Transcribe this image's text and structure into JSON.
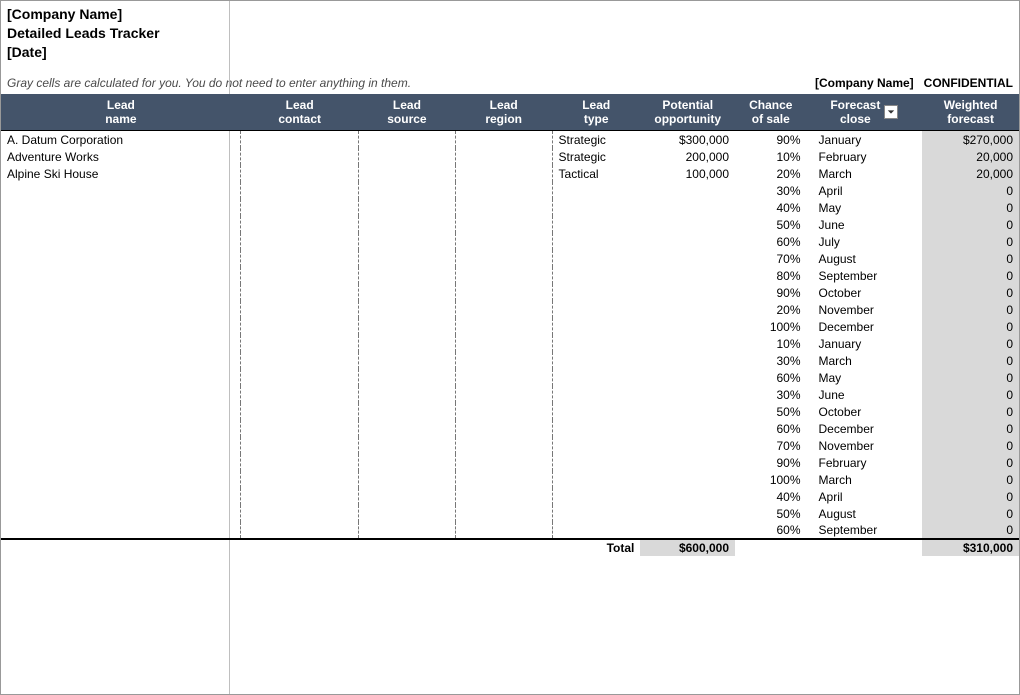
{
  "header": {
    "company_line": "[Company Name]",
    "title_line": "Detailed Leads Tracker",
    "date_line": "[Date]"
  },
  "note": "Gray cells are calculated for you. You do not need to enter anything in them.",
  "confidential": {
    "company": "[Company Name]",
    "label": "CONFIDENTIAL"
  },
  "columns": {
    "name": "Lead\nname",
    "contact": "Lead\ncontact",
    "source": "Lead\nsource",
    "region": "Lead\nregion",
    "type": "Lead\ntype",
    "potential": "Potential\nopportunity",
    "chance": "Chance\nof sale",
    "close": "Forecast\nclose",
    "weighted": "Weighted\nforecast"
  },
  "rows": [
    {
      "name": "A. Datum Corporation",
      "contact": "",
      "source": "",
      "region": "",
      "type": "Strategic",
      "potential": "$300,000",
      "chance": "90%",
      "close": "January",
      "weighted": "$270,000"
    },
    {
      "name": "Adventure Works",
      "contact": "",
      "source": "",
      "region": "",
      "type": "Strategic",
      "potential": "200,000",
      "chance": "10%",
      "close": "February",
      "weighted": "20,000"
    },
    {
      "name": "Alpine Ski House",
      "contact": "",
      "source": "",
      "region": "",
      "type": "Tactical",
      "potential": "100,000",
      "chance": "20%",
      "close": "March",
      "weighted": "20,000"
    },
    {
      "name": "",
      "contact": "",
      "source": "",
      "region": "",
      "type": "",
      "potential": "",
      "chance": "30%",
      "close": "April",
      "weighted": "0"
    },
    {
      "name": "",
      "contact": "",
      "source": "",
      "region": "",
      "type": "",
      "potential": "",
      "chance": "40%",
      "close": "May",
      "weighted": "0"
    },
    {
      "name": "",
      "contact": "",
      "source": "",
      "region": "",
      "type": "",
      "potential": "",
      "chance": "50%",
      "close": "June",
      "weighted": "0"
    },
    {
      "name": "",
      "contact": "",
      "source": "",
      "region": "",
      "type": "",
      "potential": "",
      "chance": "60%",
      "close": "July",
      "weighted": "0"
    },
    {
      "name": "",
      "contact": "",
      "source": "",
      "region": "",
      "type": "",
      "potential": "",
      "chance": "70%",
      "close": "August",
      "weighted": "0"
    },
    {
      "name": "",
      "contact": "",
      "source": "",
      "region": "",
      "type": "",
      "potential": "",
      "chance": "80%",
      "close": "September",
      "weighted": "0"
    },
    {
      "name": "",
      "contact": "",
      "source": "",
      "region": "",
      "type": "",
      "potential": "",
      "chance": "90%",
      "close": "October",
      "weighted": "0"
    },
    {
      "name": "",
      "contact": "",
      "source": "",
      "region": "",
      "type": "",
      "potential": "",
      "chance": "20%",
      "close": "November",
      "weighted": "0"
    },
    {
      "name": "",
      "contact": "",
      "source": "",
      "region": "",
      "type": "",
      "potential": "",
      "chance": "100%",
      "close": "December",
      "weighted": "0"
    },
    {
      "name": "",
      "contact": "",
      "source": "",
      "region": "",
      "type": "",
      "potential": "",
      "chance": "10%",
      "close": "January",
      "weighted": "0"
    },
    {
      "name": "",
      "contact": "",
      "source": "",
      "region": "",
      "type": "",
      "potential": "",
      "chance": "30%",
      "close": "March",
      "weighted": "0"
    },
    {
      "name": "",
      "contact": "",
      "source": "",
      "region": "",
      "type": "",
      "potential": "",
      "chance": "60%",
      "close": "May",
      "weighted": "0"
    },
    {
      "name": "",
      "contact": "",
      "source": "",
      "region": "",
      "type": "",
      "potential": "",
      "chance": "30%",
      "close": "June",
      "weighted": "0"
    },
    {
      "name": "",
      "contact": "",
      "source": "",
      "region": "",
      "type": "",
      "potential": "",
      "chance": "50%",
      "close": "October",
      "weighted": "0"
    },
    {
      "name": "",
      "contact": "",
      "source": "",
      "region": "",
      "type": "",
      "potential": "",
      "chance": "60%",
      "close": "December",
      "weighted": "0"
    },
    {
      "name": "",
      "contact": "",
      "source": "",
      "region": "",
      "type": "",
      "potential": "",
      "chance": "70%",
      "close": "November",
      "weighted": "0"
    },
    {
      "name": "",
      "contact": "",
      "source": "",
      "region": "",
      "type": "",
      "potential": "",
      "chance": "90%",
      "close": "February",
      "weighted": "0"
    },
    {
      "name": "",
      "contact": "",
      "source": "",
      "region": "",
      "type": "",
      "potential": "",
      "chance": "100%",
      "close": "March",
      "weighted": "0"
    },
    {
      "name": "",
      "contact": "",
      "source": "",
      "region": "",
      "type": "",
      "potential": "",
      "chance": "40%",
      "close": "April",
      "weighted": "0"
    },
    {
      "name": "",
      "contact": "",
      "source": "",
      "region": "",
      "type": "",
      "potential": "",
      "chance": "50%",
      "close": "August",
      "weighted": "0"
    },
    {
      "name": "",
      "contact": "",
      "source": "",
      "region": "",
      "type": "",
      "potential": "",
      "chance": "60%",
      "close": "September",
      "weighted": "0"
    }
  ],
  "totals": {
    "label": "Total",
    "potential": "$600,000",
    "weighted": "$310,000"
  }
}
